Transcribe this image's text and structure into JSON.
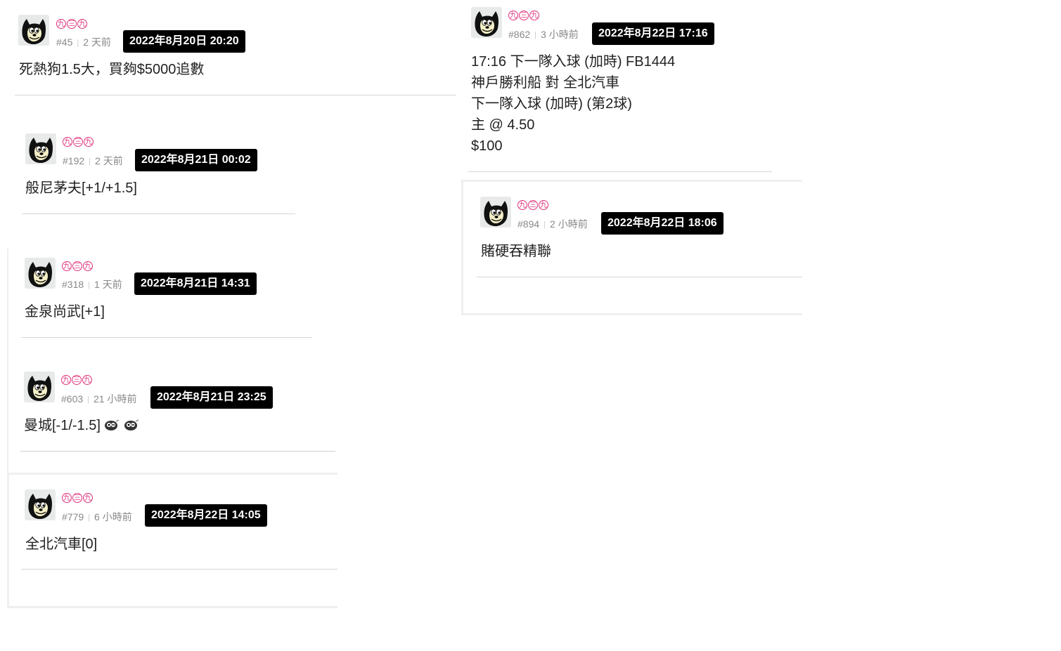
{
  "posts": [
    {
      "nick": [
        "九",
        "三",
        "九"
      ],
      "floor": "#45",
      "relative": "2 天前",
      "datetime": "2022年8月20日 20:20",
      "content": [
        "死熱狗1.5大，買夠$5000追數"
      ]
    },
    {
      "nick": [
        "九",
        "三",
        "九"
      ],
      "floor": "#192",
      "relative": "2 天前",
      "datetime": "2022年8月21日 00:02",
      "content": [
        "般尼茅夫[+1/+1.5]"
      ]
    },
    {
      "nick": [
        "九",
        "三",
        "九"
      ],
      "floor": "#318",
      "relative": "1 天前",
      "datetime": "2022年8月21日 14:31",
      "content": [
        "金泉尚武[+1]"
      ]
    },
    {
      "nick": [
        "九",
        "三",
        "九"
      ],
      "floor": "#603",
      "relative": "21 小時前",
      "datetime": "2022年8月21日 23:25",
      "content": [
        "曼城[-1/-1.5]"
      ]
    },
    {
      "nick": [
        "九",
        "三",
        "九"
      ],
      "floor": "#779",
      "relative": "6 小時前",
      "datetime": "2022年8月22日 14:05",
      "content": [
        "全北汽車[0]"
      ]
    },
    {
      "nick": [
        "九",
        "三",
        "九"
      ],
      "floor": "#862",
      "relative": "3 小時前",
      "datetime": "2022年8月22日 17:16",
      "content": [
        "17:16 下一隊入球 (加時) FB1444",
        "神戶勝利船 對 全北汽車",
        "下一隊入球 (加時) (第2球)",
        "主 @ 4.50",
        "$100"
      ]
    },
    {
      "nick": [
        "九",
        "三",
        "九"
      ],
      "floor": "#894",
      "relative": "2 小時前",
      "datetime": "2022年8月22日 18:06",
      "content": [
        "賭硬吞精聯"
      ]
    }
  ],
  "icons": {
    "avatar": "cartoon-cat-avatar-icon",
    "emoji": "winking-emoji-icon"
  },
  "colors": {
    "nick": "#e0337c",
    "tooltip_bg": "#000000",
    "meta": "#888888"
  }
}
